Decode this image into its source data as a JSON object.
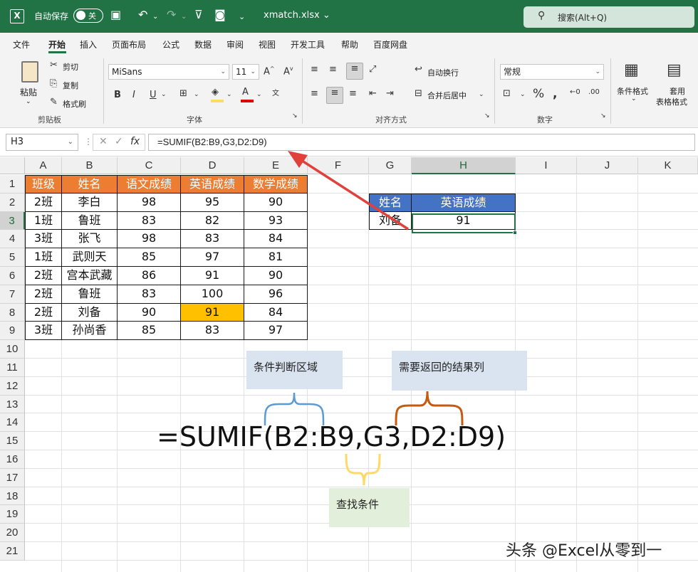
{
  "titlebar": {
    "autosave_label": "自动保存",
    "autosave_state": "关",
    "filename": "xmatch.xlsx",
    "search_text": "搜索(Alt+Q)"
  },
  "menu": [
    "文件",
    "开始",
    "插入",
    "页面布局",
    "公式",
    "数据",
    "审阅",
    "视图",
    "开发工具",
    "帮助",
    "百度网盘"
  ],
  "ribbon": {
    "clipboard": {
      "paste": "粘贴",
      "cut": "剪切",
      "copy": "复制",
      "format_painter": "格式刷",
      "label": "剪贴板"
    },
    "font": {
      "name": "MiSans",
      "size": "11",
      "bold": "B",
      "italic": "I",
      "underline": "U",
      "label": "字体"
    },
    "alignment": {
      "wrap": "自动换行",
      "merge": "合并后居中",
      "label": "对齐方式"
    },
    "number": {
      "format": "常规",
      "label": "数字"
    },
    "styles": {
      "conditional": "条件格式",
      "table_format_1": "套用",
      "table_format_2": "表格格式"
    }
  },
  "formula_bar": {
    "name_box": "H3",
    "fx": "fx",
    "formula": "=SUMIF(B2:B9,G3,D2:D9)"
  },
  "columns": [
    "A",
    "B",
    "C",
    "D",
    "E",
    "F",
    "G",
    "H",
    "I",
    "J",
    "K"
  ],
  "rows": [
    "1",
    "2",
    "3",
    "4",
    "5",
    "6",
    "7",
    "8",
    "9",
    "10",
    "11",
    "12",
    "13",
    "14",
    "15",
    "16",
    "17",
    "18",
    "19",
    "20",
    "21"
  ],
  "table": {
    "headers": [
      "班级",
      "姓名",
      "语文成绩",
      "英语成绩",
      "数学成绩"
    ],
    "rows": [
      [
        "2班",
        "李白",
        "98",
        "95",
        "90"
      ],
      [
        "1班",
        "鲁班",
        "83",
        "82",
        "93"
      ],
      [
        "3班",
        "张飞",
        "98",
        "83",
        "84"
      ],
      [
        "1班",
        "武则天",
        "85",
        "97",
        "81"
      ],
      [
        "2班",
        "宫本武藏",
        "86",
        "91",
        "90"
      ],
      [
        "2班",
        "鲁班",
        "83",
        "100",
        "96"
      ],
      [
        "2班",
        "刘备",
        "90",
        "91",
        "84"
      ],
      [
        "3班",
        "孙尚香",
        "85",
        "83",
        "97"
      ]
    ],
    "highlight_color": "#ffc000",
    "header_color": "#ed7d31"
  },
  "lookup": {
    "headers": [
      "姓名",
      "英语成绩"
    ],
    "values": [
      "刘备",
      "91"
    ],
    "header_color": "#4472c4"
  },
  "annotations": {
    "range_label": "条件判断区域",
    "return_label": "需要返回的结果列",
    "criteria_label": "查找条件",
    "big_formula": "=SUMIF(B2:B9,G3,D2:D9)",
    "watermark": "头条 @Excel从零到一"
  },
  "colors": {
    "accent": "#217346",
    "arrow": "#e0413a",
    "brace_blue": "#5b9bd5",
    "brace_yellow": "#ffd966",
    "brace_orange": "#c55a11"
  }
}
